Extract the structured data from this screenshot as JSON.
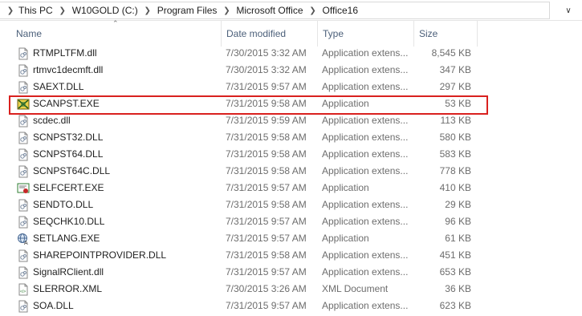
{
  "breadcrumb": [
    "This PC",
    "W10GOLD (C:)",
    "Program Files",
    "Microsoft Office",
    "Office16"
  ],
  "columns": {
    "name": "Name",
    "date": "Date modified",
    "type": "Type",
    "size": "Size"
  },
  "accent_highlight_color": "#d9211f",
  "files": [
    {
      "name": "RTMPLTFM.dll",
      "date": "7/30/2015 3:32 AM",
      "type": "Application extens...",
      "size": "8,545 KB",
      "icon": "dll-icon"
    },
    {
      "name": "rtmvc1decmft.dll",
      "date": "7/30/2015 3:32 AM",
      "type": "Application extens...",
      "size": "347 KB",
      "icon": "dll-icon"
    },
    {
      "name": "SAEXT.DLL",
      "date": "7/31/2015 9:57 AM",
      "type": "Application extens...",
      "size": "297 KB",
      "icon": "dll-icon"
    },
    {
      "name": "SCANPST.EXE",
      "date": "7/31/2015 9:58 AM",
      "type": "Application",
      "size": "53 KB",
      "icon": "scanpst-icon",
      "highlight": true
    },
    {
      "name": "scdec.dll",
      "date": "7/31/2015 9:59 AM",
      "type": "Application extens...",
      "size": "113 KB",
      "icon": "dll-icon"
    },
    {
      "name": "SCNPST32.DLL",
      "date": "7/31/2015 9:58 AM",
      "type": "Application extens...",
      "size": "580 KB",
      "icon": "dll-icon"
    },
    {
      "name": "SCNPST64.DLL",
      "date": "7/31/2015 9:58 AM",
      "type": "Application extens...",
      "size": "583 KB",
      "icon": "dll-icon"
    },
    {
      "name": "SCNPST64C.DLL",
      "date": "7/31/2015 9:58 AM",
      "type": "Application extens...",
      "size": "778 KB",
      "icon": "dll-icon"
    },
    {
      "name": "SELFCERT.EXE",
      "date": "7/31/2015 9:57 AM",
      "type": "Application",
      "size": "410 KB",
      "icon": "certificate-icon"
    },
    {
      "name": "SENDTO.DLL",
      "date": "7/31/2015 9:58 AM",
      "type": "Application extens...",
      "size": "29 KB",
      "icon": "dll-icon"
    },
    {
      "name": "SEQCHK10.DLL",
      "date": "7/31/2015 9:57 AM",
      "type": "Application extens...",
      "size": "96 KB",
      "icon": "dll-icon"
    },
    {
      "name": "SETLANG.EXE",
      "date": "7/31/2015 9:57 AM",
      "type": "Application",
      "size": "61 KB",
      "icon": "language-icon"
    },
    {
      "name": "SHAREPOINTPROVIDER.DLL",
      "date": "7/31/2015 9:58 AM",
      "type": "Application extens...",
      "size": "451 KB",
      "icon": "dll-icon"
    },
    {
      "name": "SignalRClient.dll",
      "date": "7/31/2015 9:57 AM",
      "type": "Application extens...",
      "size": "653 KB",
      "icon": "dll-icon"
    },
    {
      "name": "SLERROR.XML",
      "date": "7/30/2015 3:26 AM",
      "type": "XML Document",
      "size": "36 KB",
      "icon": "xml-icon"
    },
    {
      "name": "SOA.DLL",
      "date": "7/31/2015 9:57 AM",
      "type": "Application extens...",
      "size": "623 KB",
      "icon": "dll-icon"
    }
  ]
}
